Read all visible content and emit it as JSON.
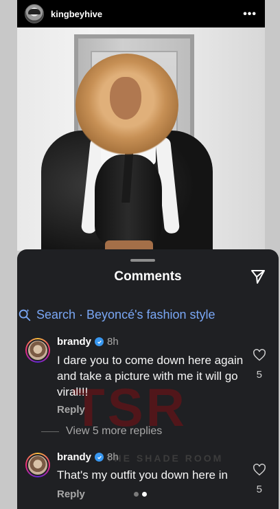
{
  "post": {
    "username": "kingbeyhive",
    "more_icon": "ellipsis-icon"
  },
  "sheet": {
    "title": "Comments",
    "search_text": "Search · Beyoncé's fashion style"
  },
  "comments": [
    {
      "username": "brandy",
      "time": "8h",
      "text": "I dare you to come down here again and take a picture with me it will go viral!!!",
      "reply_label": "Reply",
      "likes": "5",
      "view_replies": "View 5 more replies"
    },
    {
      "username": "brandy",
      "time": "8h",
      "text": "That's my outfit you down here in",
      "reply_label": "Reply",
      "likes": "5"
    }
  ],
  "watermark": {
    "logo": "TSR",
    "text": "THE SHADE ROOM"
  },
  "colors": {
    "sheet_bg": "#1f2023",
    "search_blue": "#7aa7f5",
    "verified_blue": "#3897f0"
  }
}
